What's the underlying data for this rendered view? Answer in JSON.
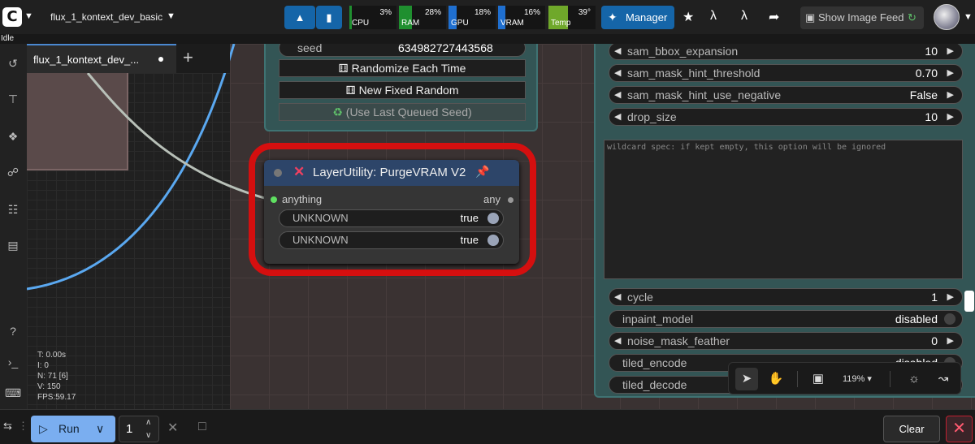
{
  "topbar": {
    "logo": "C",
    "workflow_name": "flux_1_kontext_dev_basic",
    "stats": [
      {
        "label": "CPU",
        "value": "3%",
        "color": "#1f8f2f"
      },
      {
        "label": "RAM",
        "value": "28%",
        "color": "#1f8f2f"
      },
      {
        "label": "GPU",
        "value": "18%",
        "color": "#1f6fd0"
      },
      {
        "label": "VRAM",
        "value": "16%",
        "color": "#1f6fd0"
      },
      {
        "label": "Temp",
        "value": "39°",
        "color": "#6fa82a"
      }
    ],
    "manager_label": "Manager",
    "show_feed_label": "Show Image Feed"
  },
  "status": "Idle",
  "tab": {
    "title": "flux_1_kontext_dev_..."
  },
  "canvas_stats": {
    "t": "T: 0.00s",
    "i": "I: 0",
    "n": "N: 71 [6]",
    "v": "V: 150",
    "fps": "FPS:59.17"
  },
  "seed_node": {
    "seed_label": "seed",
    "seed_value": "634982727443568",
    "randomize_label": "Randomize Each Time",
    "new_fixed_label": "New Fixed Random",
    "last_queued_label": "(Use Last Queued Seed)"
  },
  "purge_node": {
    "title": "LayerUtility: PurgeVRAM V2",
    "input_name": "anything",
    "output_name": "any",
    "toggles": [
      {
        "name": "UNKNOWN",
        "value": "true"
      },
      {
        "name": "UNKNOWN",
        "value": "true"
      }
    ]
  },
  "big_node": {
    "widgets_top": [
      {
        "name": "sam_bbox_expansion",
        "value": "10"
      },
      {
        "name": "sam_mask_hint_threshold",
        "value": "0.70"
      },
      {
        "name": "sam_mask_hint_use_negative",
        "value": "False"
      },
      {
        "name": "drop_size",
        "value": "10"
      }
    ],
    "textarea_placeholder": "wildcard spec: if kept empty, this option will be ignored",
    "cycle": {
      "name": "cycle",
      "value": "1"
    },
    "inpaint_model": {
      "name": "inpaint_model",
      "value": "disabled"
    },
    "noise_mask_feather": {
      "name": "noise_mask_feather",
      "value": "0"
    },
    "tiled_encode": {
      "name": "tiled_encode",
      "value": "disabled"
    },
    "tiled_decode": {
      "name": "tiled_decode"
    }
  },
  "canvas_toolbar": {
    "zoom": "119%"
  },
  "bottom": {
    "run_label": "Run",
    "queue_count": "1",
    "clear_label": "Clear"
  },
  "colors": {
    "accent": "#1565a8",
    "highlight": "#d50f0f",
    "run": "#7aaef0"
  }
}
